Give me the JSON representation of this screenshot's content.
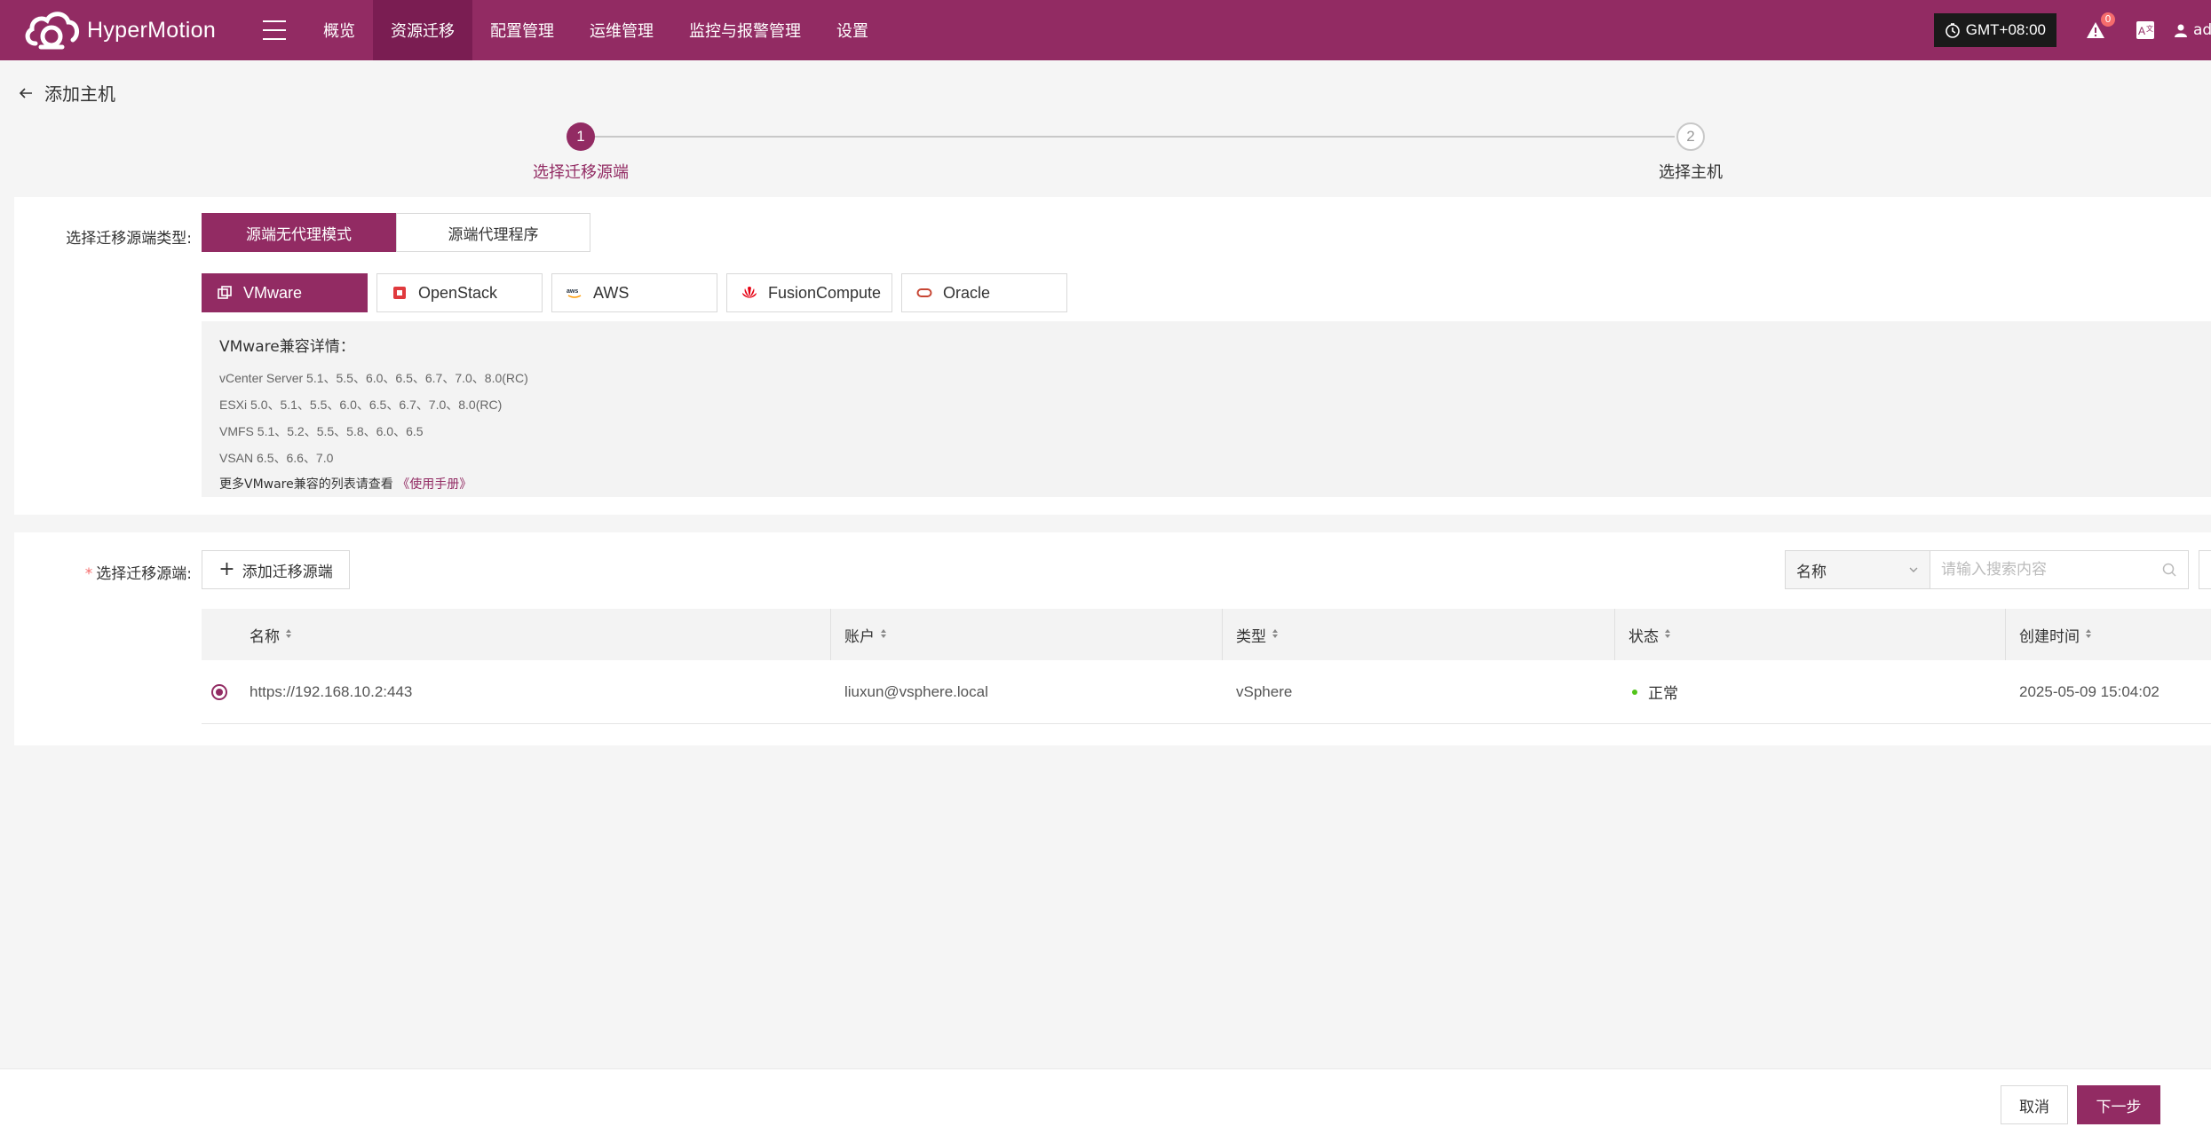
{
  "app": {
    "name": "HyperMotion"
  },
  "nav": {
    "items": [
      {
        "label": "概览"
      },
      {
        "label": "资源迁移"
      },
      {
        "label": "配置管理"
      },
      {
        "label": "运维管理"
      },
      {
        "label": "监控与报警管理"
      },
      {
        "label": "设置"
      }
    ],
    "active_index": 1
  },
  "header_right": {
    "timezone": "GMT+08:00",
    "alert_count": "0",
    "user": "ad"
  },
  "page": {
    "title": "添加主机"
  },
  "steps": [
    {
      "number": "1",
      "label": "选择迁移源端",
      "state": "active"
    },
    {
      "number": "2",
      "label": "选择主机",
      "state": "todo"
    }
  ],
  "source_type": {
    "label": "选择迁移源端类型:",
    "modes": [
      {
        "label": "源端无代理模式",
        "selected": true
      },
      {
        "label": "源端代理程序",
        "selected": false
      }
    ],
    "platforms": [
      {
        "label": "VMware",
        "icon": "vmware-icon",
        "selected": true
      },
      {
        "label": "OpenStack",
        "icon": "openstack-icon",
        "selected": false
      },
      {
        "label": "AWS",
        "icon": "aws-icon",
        "selected": false
      },
      {
        "label": "FusionCompute",
        "icon": "huawei-icon",
        "selected": false
      },
      {
        "label": "Oracle",
        "icon": "oracle-icon",
        "selected": false
      }
    ],
    "compat": {
      "title": "VMware兼容详情：",
      "lines": [
        "vCenter Server 5.1、5.5、6.0、6.5、6.7、7.0、8.0(RC)",
        "ESXi 5.0、5.1、5.5、6.0、6.5、6.7、7.0、8.0(RC)",
        "VMFS 5.1、5.2、5.5、5.8、6.0、6.5",
        "VSAN 6.5、6.6、7.0"
      ],
      "more_text": "更多VMware兼容的列表请查看",
      "more_link": "《使用手册》"
    }
  },
  "source_select": {
    "label": "选择迁移源端:",
    "add_button": "添加迁移源端",
    "search": {
      "field": "名称",
      "placeholder": "请输入搜索内容"
    },
    "columns": [
      "名称",
      "账户",
      "类型",
      "状态",
      "创建时间"
    ],
    "rows": [
      {
        "selected": true,
        "name": "https://192.168.10.2:443",
        "account": "liuxun@vsphere.local",
        "type": "vSphere",
        "status": "正常",
        "created": "2025-05-09 15:04:02"
      }
    ]
  },
  "footer": {
    "cancel": "取消",
    "next": "下一步"
  },
  "colors": {
    "brand": "#922b63",
    "brand_dark": "#7a1d52",
    "status_ok": "#52c41a"
  }
}
